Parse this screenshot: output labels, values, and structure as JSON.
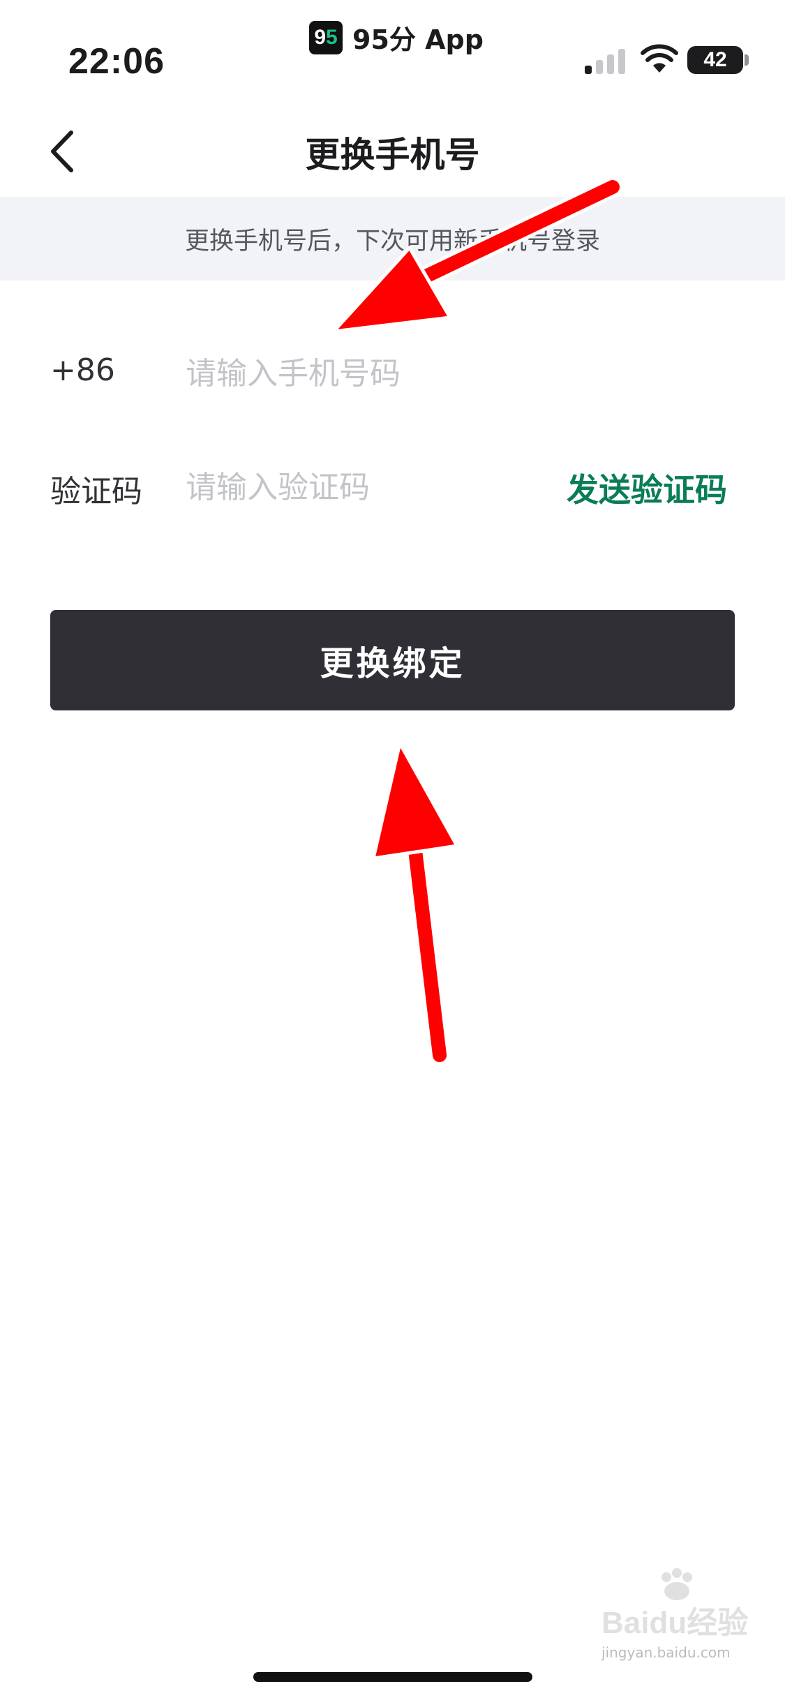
{
  "status_bar": {
    "time": "22:06",
    "app_name": "95分 App",
    "app_icon_text": {
      "part1": "9",
      "part2": "5"
    },
    "battery": "42"
  },
  "nav": {
    "title": "更换手机号",
    "back_icon": "chevron-left-icon"
  },
  "notice": "更换手机号后，下次可用新手机号登录",
  "form": {
    "country_code": "+86",
    "phone_placeholder": "请输入手机号码",
    "code_label": "验证码",
    "code_placeholder": "请输入验证码",
    "send_code": "发送验证码"
  },
  "primary_button": "更换绑定",
  "watermark": {
    "logo_text": "Baidu经验",
    "url": "jingyan.baidu.com"
  },
  "colors": {
    "accent_green": "#0a7d55",
    "button_bg": "#2f2f35",
    "notice_bg": "#f2f3f7",
    "annotation_arrow": "#ff0000"
  }
}
